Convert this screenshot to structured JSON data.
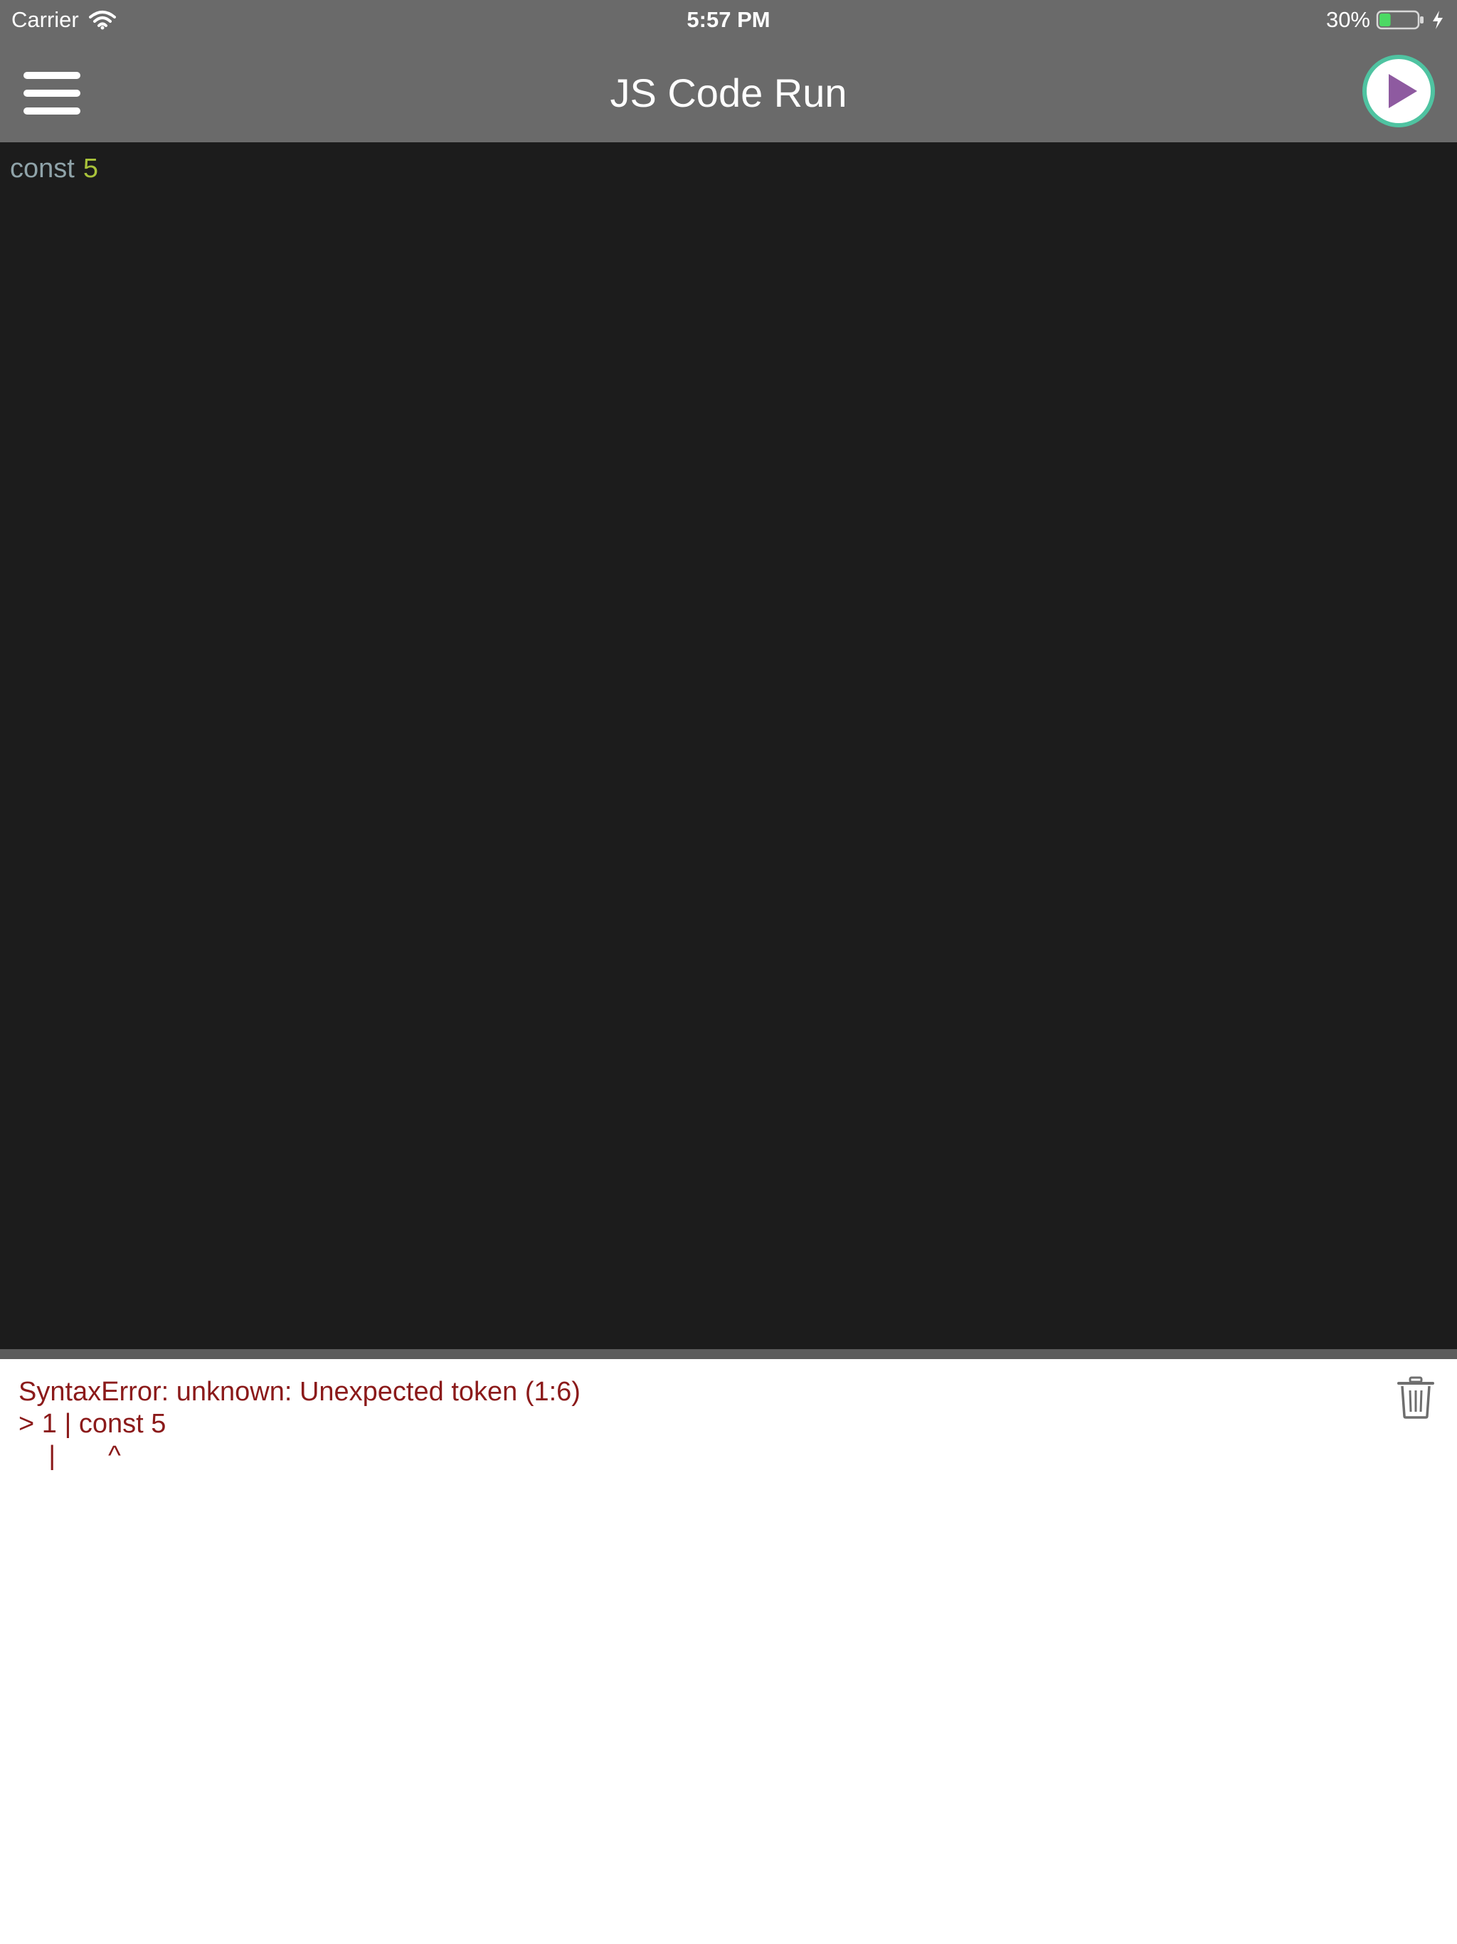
{
  "status_bar": {
    "carrier": "Carrier",
    "time": "5:57 PM",
    "battery_percent": "30%",
    "battery_level": 0.3,
    "icons": [
      "wifi-icon",
      "battery-icon",
      "charging-bolt-icon"
    ]
  },
  "nav": {
    "title": "JS Code Run",
    "menu_icon": "hamburger-menu-icon",
    "run_icon": "play-icon"
  },
  "editor": {
    "tokens": [
      {
        "text": "const",
        "kind": "keyword"
      },
      {
        "text": "5",
        "kind": "number"
      }
    ]
  },
  "console": {
    "lines": [
      "SyntaxError: unknown: Unexpected token (1:6)",
      "> 1 | const 5",
      "    |       ^"
    ],
    "clear_icon": "trash-icon"
  },
  "colors": {
    "bar_background": "#6a6a6a",
    "editor_background": "#1c1c1c",
    "keyword": "#8fa3a9",
    "number": "#a8c23a",
    "error_text": "#8b1a1a",
    "run_ring": "#4fc3a1",
    "run_triangle": "#8e5aa0"
  }
}
